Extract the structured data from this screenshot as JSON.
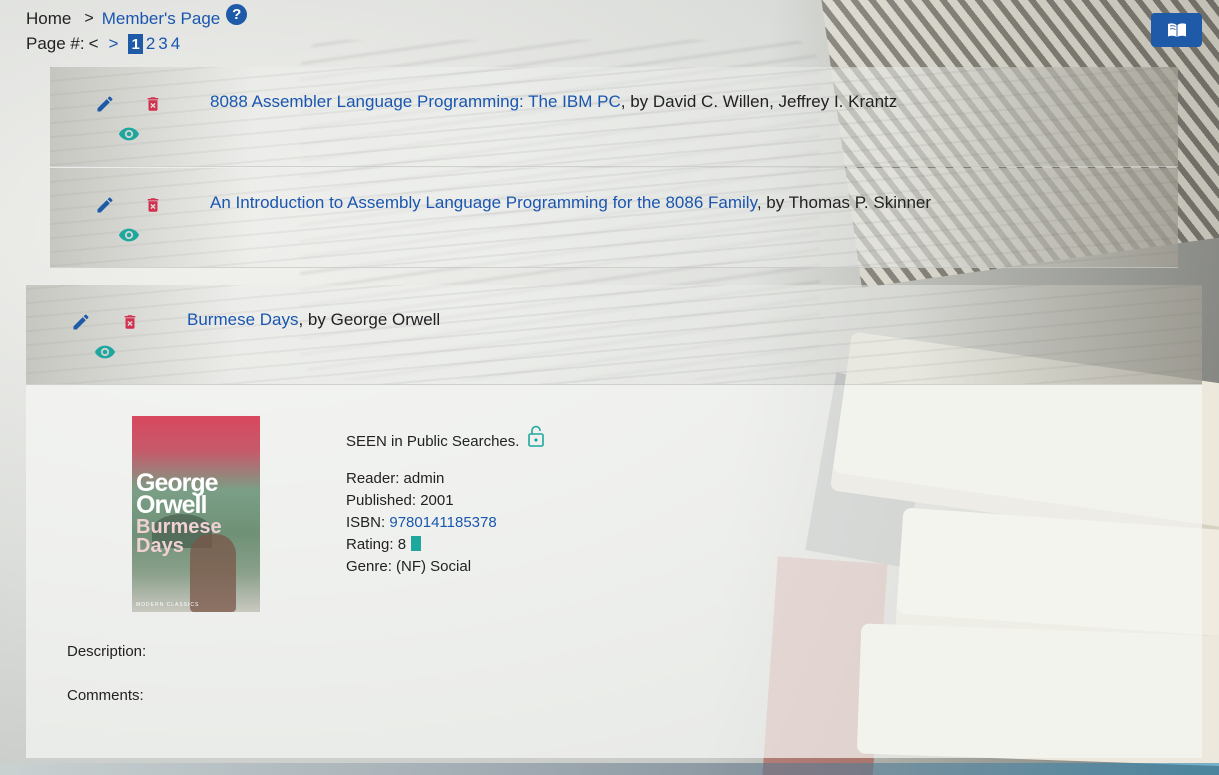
{
  "breadcrumb": {
    "home": "Home",
    "separator": ">",
    "current": "Member's Page",
    "help": "?"
  },
  "pager": {
    "label": "Page #:",
    "prev": "<",
    "next": ">",
    "pages": [
      "1",
      "2",
      "3",
      "4"
    ],
    "current": "1"
  },
  "books": [
    {
      "title": "8088 Assembler Language Programming: The IBM PC",
      "byline": ", by David C. Willen, Jeffrey I. Krantz"
    },
    {
      "title": "An Introduction to Assembly Language Programming for the 8086 Family",
      "byline": ", by Thomas P. Skinner"
    },
    {
      "title": "Burmese Days",
      "byline": ", by George Orwell"
    }
  ],
  "detail": {
    "cover": {
      "author": "George Orwell",
      "title": "Burmese Days",
      "series": "MODERN CLASSICS"
    },
    "visibility": "SEEN in Public Searches.",
    "reader": "Reader: admin",
    "published": "Published: 2001",
    "isbn_label": "ISBN: ",
    "isbn": "9780141185378",
    "rating": "Rating: 8",
    "rating_value": 8,
    "genre": "Genre: (NF) Social",
    "description_label": "Description:",
    "comments_label": "Comments:"
  },
  "colors": {
    "accent": "#1e5aa8",
    "link": "#1a56b0",
    "delete": "#d32f4f",
    "view": "#1ea79f"
  },
  "icons": {
    "edit": "pencil-icon",
    "delete": "trash-icon",
    "view": "eye-icon",
    "lock": "unlock-icon",
    "toggle": "book-open-icon"
  }
}
